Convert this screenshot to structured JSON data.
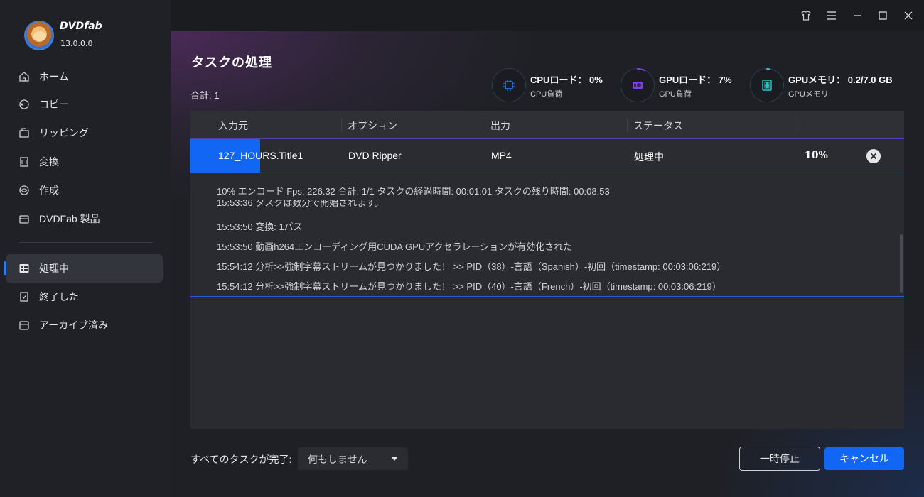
{
  "app": {
    "brand": "DVDfab",
    "version": "13.0.0.0"
  },
  "sidebar": {
    "items": [
      {
        "label": "ホーム",
        "icon": "home-icon"
      },
      {
        "label": "コピー",
        "icon": "copy-icon"
      },
      {
        "label": "リッピング",
        "icon": "ripping-icon"
      },
      {
        "label": "変換",
        "icon": "convert-icon"
      },
      {
        "label": "作成",
        "icon": "create-icon"
      },
      {
        "label": "DVDFab 製品",
        "icon": "products-icon"
      },
      {
        "label": "処理中",
        "icon": "processing-icon",
        "active": true
      },
      {
        "label": "終了した",
        "icon": "finished-icon"
      },
      {
        "label": "アーカイブ済み",
        "icon": "archive-icon"
      }
    ]
  },
  "main": {
    "title": "タスクの処理",
    "total": "合計: 1"
  },
  "stats": {
    "cpu": {
      "title": "CPUロード：  0%",
      "sub": "CPU負荷",
      "percent": 0
    },
    "gpu": {
      "title": "GPUロード：  7%",
      "sub": "GPU負荷",
      "percent": 7
    },
    "mem": {
      "title": "GPUメモリ：  0.2/7.0 GB",
      "sub": "GPUメモリ",
      "fraction": 0.029
    }
  },
  "table": {
    "headers": {
      "source": "入力元",
      "option": "オプション",
      "output": "出力",
      "status": "ステータス"
    },
    "row": {
      "source": "127_HOURS.Title1",
      "option": "DVD Ripper",
      "output": "MP4",
      "status": "処理中",
      "progress": "10%",
      "progress_value": 0.1
    }
  },
  "log": {
    "summary": "10%  エンコード Fps: 226.32   合計: 1/1   タスクの経過時間: 00:01:01   タスクの残り時間: 00:08:53",
    "partial": "15:53:36  タスクは数分で開始されます。",
    "lines": [
      "15:53:50  変換: 1パス",
      "15:53:50  動画h264エンコーディング用CUDA GPUアクセラレーションが有効化された",
      "15:54:12  分析>>強制字幕ストリームが見つかりました！  >> PID（38）-言語（Spanish）-初回（timestamp: 00:03:06:219）",
      "15:54:12  分析>>強制字幕ストリームが見つかりました！  >> PID（40）-言語（French）-初回（timestamp: 00:03:06:219）"
    ]
  },
  "footer": {
    "complete_label": "すべてのタスクが完了:",
    "complete_value": "何もしません",
    "pause": "一時停止",
    "cancel": "キャンセル"
  },
  "colors": {
    "accent": "#1166f4",
    "purple": "#7b3fe4",
    "teal": "#27c4c4"
  }
}
